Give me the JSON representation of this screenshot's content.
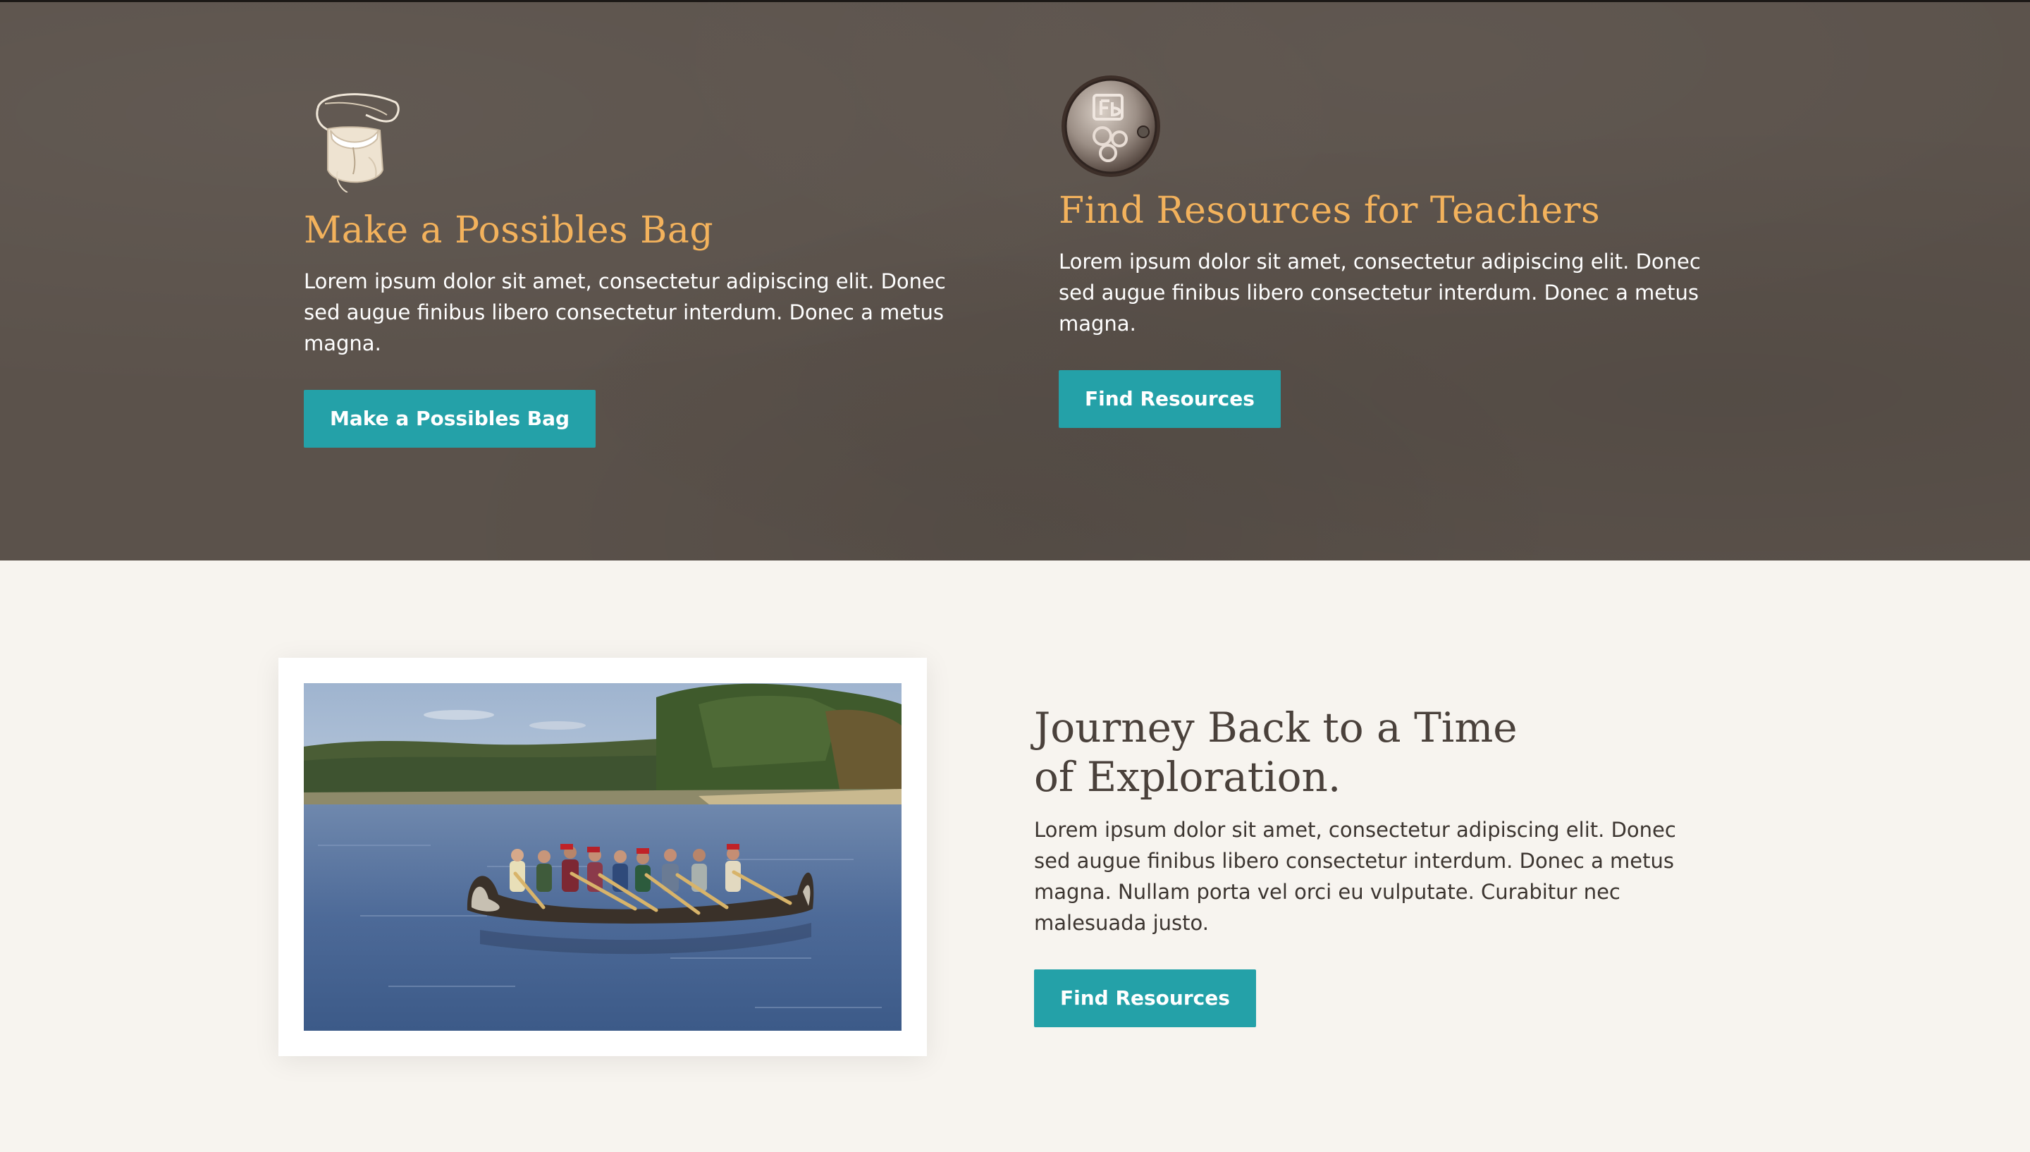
{
  "features": [
    {
      "icon": "pouch-icon",
      "title": "Make a Possibles Bag",
      "body": "Lorem ipsum dolor sit amet, consectetur adipiscing elit. Donec sed augue finibus libero consectetur interdum. Donec a metus magna.",
      "button": "Make a Possibles Bag"
    },
    {
      "icon": "coin-icon",
      "title": "Find Resources for Teachers",
      "body": "Lorem ipsum dolor sit amet, consectetur adipiscing elit. Donec sed augue finibus libero consectetur interdum. Donec a metus magna.",
      "button": "Find Resources"
    }
  ],
  "journey": {
    "title": "Journey Back to a Time of Exploration.",
    "body": "Lorem ipsum dolor sit amet, consectetur adipiscing elit. Donec sed augue finibus libero consectetur interdum. Donec a metus magna. Nullam porta vel orci eu vulputate. Curabitur nec malesuada justo.",
    "button": "Find Resources",
    "image": "canoe-voyageurs-photo"
  },
  "colors": {
    "dark_band": "#5b524b",
    "accent_heading": "#f3b25c",
    "button": "#24a1a8",
    "light_band": "#f7f4ef"
  }
}
